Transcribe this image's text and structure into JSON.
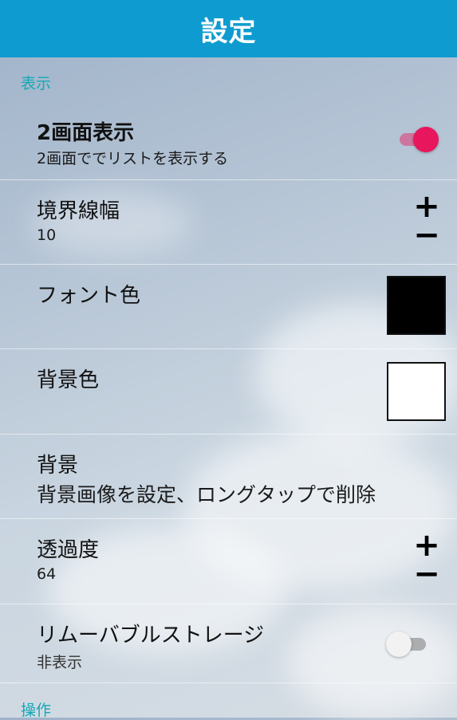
{
  "header": {
    "title": "設定"
  },
  "sections": [
    {
      "label": "表示"
    },
    {
      "label": "操作"
    }
  ],
  "settings": {
    "dual_screen": {
      "title": "2画面表示",
      "subtitle": "2画面ででリストを表示する",
      "enabled": true
    },
    "border_width": {
      "title": "境界線幅",
      "value": "10",
      "plus": "+",
      "minus": "−"
    },
    "font_color": {
      "title": "フォント色",
      "color": "#000000"
    },
    "bg_color": {
      "title": "背景色",
      "color": "#ffffff"
    },
    "background": {
      "title": "背景",
      "subtitle": "背景画像を設定、ロングタップで削除"
    },
    "transparency": {
      "title": "透過度",
      "value": "64",
      "plus": "+",
      "minus": "−"
    },
    "removable_storage": {
      "title": "リムーバブルストレージ",
      "subtitle": "非表示",
      "enabled": false
    }
  },
  "colors": {
    "accent": "#0e9bd0",
    "toggle_on": "#e8175d",
    "section": "#13a8b6"
  }
}
